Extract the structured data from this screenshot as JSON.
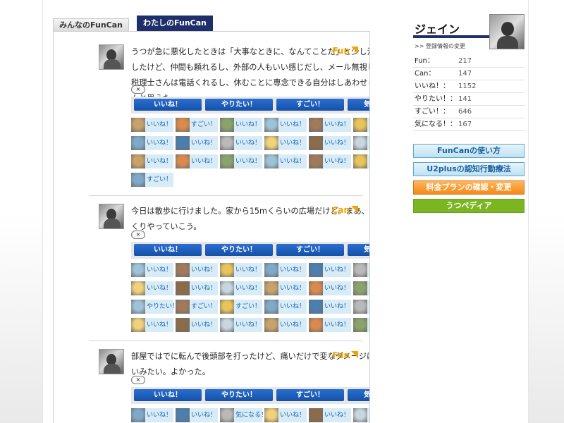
{
  "tabs": [
    {
      "label": "みんなのFunCan",
      "active": false
    },
    {
      "label": "わたしのFunCan",
      "active": true
    }
  ],
  "close_label": "×",
  "action_buttons": [
    "いいね！",
    "やりたい！",
    "すごい！",
    "気になる！"
  ],
  "posts": [
    {
      "text": "うつが急に悪化したときは「大事なときに、なんてことだ」と少し混乱したけど、仲間も頼れるし、外部の人もいい感じだし、メール無視した税理士さんは電話くれるし、休むことに専念できる自分はしあわせじゃんと思えた。",
      "badge": "Fun",
      "reactions": [
        "いいね！",
        "すごい！",
        "いいね！",
        "いいね！",
        "いいね！",
        "いいね！",
        "いいね！",
        "いいね！",
        "いいね！",
        "いいね！",
        "いいね！",
        "いいね！",
        "いいね！",
        "いいね！",
        "いいね！",
        "いいね！",
        "いいね！",
        "すごい！",
        "すごい！"
      ]
    },
    {
      "text": "今日は散歩に行けました。家から15mくらいの広場だけど。まあ、ゆっくりやっていこう。",
      "badge": "Can",
      "reactions": [
        "いいね！",
        "いいね！",
        "いいね！",
        "いいね！",
        "いいね！",
        "いいね！",
        "いいね！",
        "いいね！",
        "いいね！",
        "いいね！",
        "いいね！",
        "いいね！",
        "やりたい！",
        "すごい！",
        "すごい！",
        "いいね！",
        "いいね！",
        "いいね！",
        "いいね！",
        "いいね！",
        "いいね！",
        "いいね！",
        "いいね！",
        "いいね！"
      ]
    },
    {
      "text": "部屋ではでに転んで後頭部を打ったけど、痛いだけで変なダメージはないみたい。よかった。",
      "badge": "Fun",
      "reactions": [
        "いいね！",
        "いいね！",
        "気になる！",
        "いいね！",
        "いいね！",
        "いいね！"
      ]
    }
  ],
  "sidebar": {
    "user_name": "ジェイン",
    "register_link": ">> 登録情報の変更",
    "stats": [
      {
        "label": "Fun：",
        "value": "217"
      },
      {
        "label": "Can：",
        "value": "147"
      },
      {
        "label": "いいね！：",
        "value": "1152"
      },
      {
        "label": "やりたい！：",
        "value": "141"
      },
      {
        "label": "すごい！：",
        "value": "646"
      },
      {
        "label": "気になる！：",
        "value": "167"
      }
    ],
    "buttons": [
      {
        "label": "FunCanの使い方",
        "style": "blue1"
      },
      {
        "label": "U2plusの認知行動療法",
        "style": "blue2"
      },
      {
        "label": "料金プランの確認・変更",
        "style": "orange"
      },
      {
        "label": "うつペディア",
        "style": "green"
      }
    ]
  },
  "colors": {
    "navy": "#1f2f6b",
    "accent_orange": "#f0a400",
    "button_blue": "#1a5cb8",
    "reaction_bg": "#d7ecf7"
  }
}
